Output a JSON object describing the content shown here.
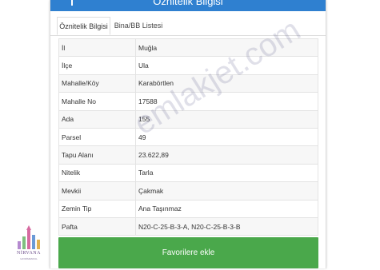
{
  "header": {
    "title": "Öznitelik Bilgisi",
    "info_icon": "info-icon",
    "color": "#2f80d0"
  },
  "tabs": [
    {
      "label": "Öznitelik Bilgisi",
      "active": true
    },
    {
      "label": "Bina/BB Listesi",
      "active": false
    }
  ],
  "attributes": [
    {
      "label": "İl",
      "value": "Muğla"
    },
    {
      "label": "İlçe",
      "value": "Ula"
    },
    {
      "label": "Mahalle/Köy",
      "value": "Karabörtlen"
    },
    {
      "label": "Mahalle No",
      "value": "17588"
    },
    {
      "label": "Ada",
      "value": "155"
    },
    {
      "label": "Parsel",
      "value": "49"
    },
    {
      "label": "Tapu Alanı",
      "value": "23.622,89"
    },
    {
      "label": "Nitelik",
      "value": "Tarla"
    },
    {
      "label": "Mevkii",
      "value": "Çakmak"
    },
    {
      "label": "Zemin Tip",
      "value": "Ana Taşınmaz"
    },
    {
      "label": "Pafta",
      "value": "N20-C-25-B-3-A, N20-C-25-B-3-B"
    }
  ],
  "favorite_button": {
    "label": "Favorilere ekle",
    "color": "#4aa84b"
  },
  "watermark": {
    "text": "emlakjet.com"
  },
  "logo": {
    "name": "NİRVANA",
    "subtitle": "GAYRİMENKUL"
  }
}
